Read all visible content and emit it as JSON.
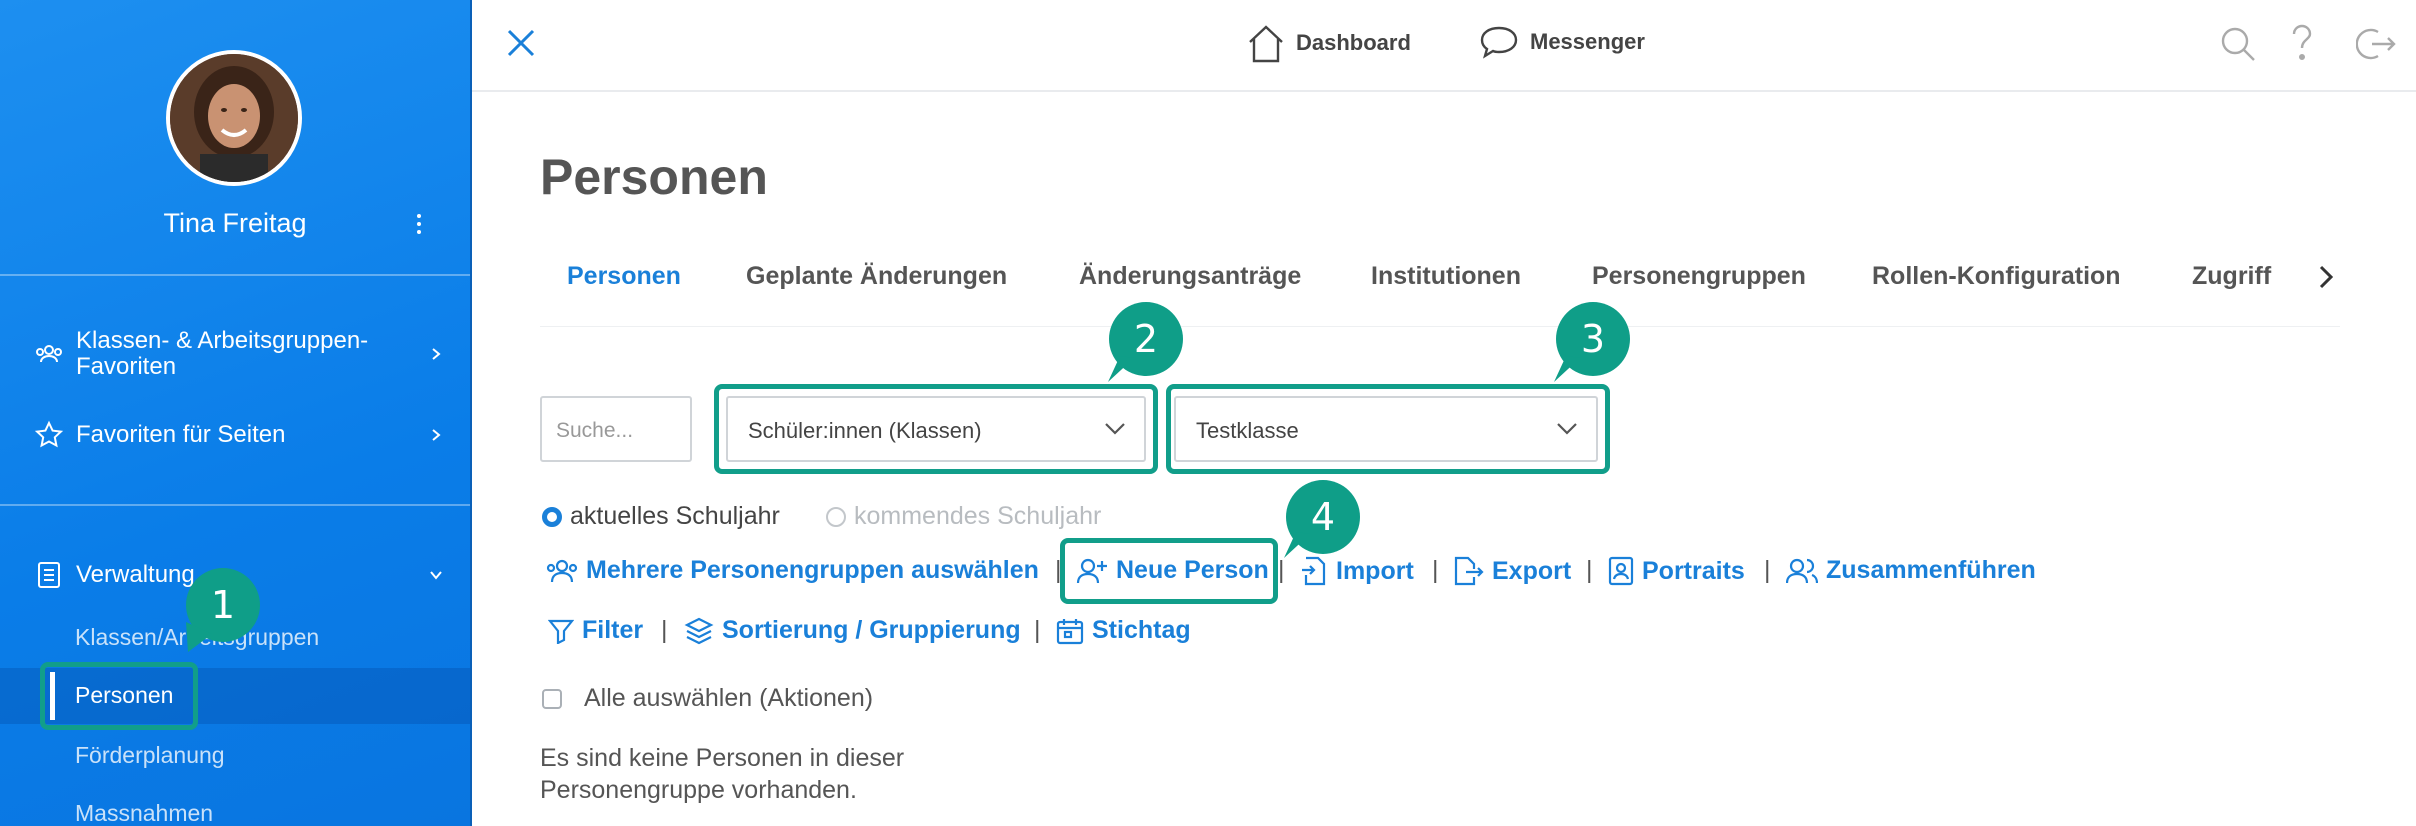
{
  "colors": {
    "sidebar": "#0a7de8",
    "accent": "#1a80d9",
    "highlight": "#119e8a",
    "text": "#555555"
  },
  "sidebar": {
    "user_name": "Tina Freitag",
    "nav": [
      {
        "label": "Klassen- & Arbeitsgruppen-Favoriten",
        "icon": "users-group-icon"
      },
      {
        "label": "Favoriten für Seiten",
        "icon": "star-icon"
      },
      {
        "label": "Verwaltung",
        "icon": "clipboard-list-icon"
      }
    ],
    "sub_items": [
      "Klassen/Arbeitsgruppen",
      "Personen",
      "Förderplanung",
      "Massnahmen"
    ]
  },
  "topbar": {
    "dashboard_label": "Dashboard",
    "messenger_label": "Messenger"
  },
  "main": {
    "title": "Personen",
    "tabs": [
      "Personen",
      "Geplante Änderungen",
      "Änderungsanträge",
      "Institutionen",
      "Personengruppen",
      "Rollen-Konfiguration",
      "Zugriff"
    ],
    "search_placeholder": "Suche...",
    "group_type_select": "Schüler:innen (Klassen)",
    "group_select": "Testklasse",
    "radio_current": "aktuelles Schuljahr",
    "radio_next": "kommendes Schuljahr",
    "actions": {
      "multi_group": "Mehrere Personengruppen auswählen",
      "new_person": "Neue Person",
      "import": "Import",
      "export": "Export",
      "portraits": "Portraits",
      "merge": "Zusammenführen",
      "filter": "Filter",
      "sort": "Sortierung / Gruppierung",
      "key_date": "Stichtag"
    },
    "separator": "|",
    "select_all": "Alle auswählen (Aktionen)",
    "empty_message": "Es sind keine Personen in dieser Personengruppe vorhanden."
  },
  "callouts": [
    "1",
    "2",
    "3",
    "4"
  ]
}
